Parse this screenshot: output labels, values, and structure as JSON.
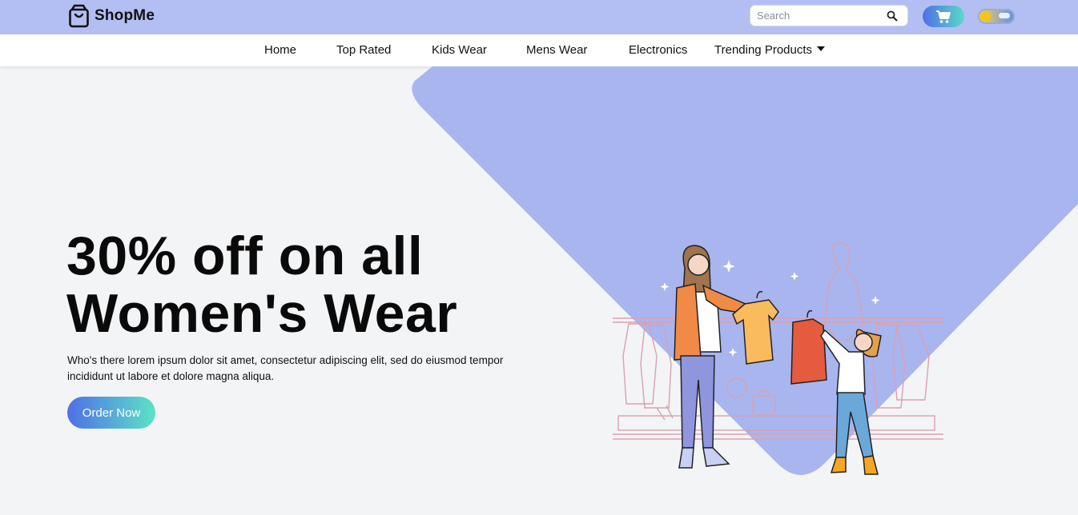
{
  "header": {
    "brand": "ShopMe",
    "search": {
      "placeholder": "Search",
      "value": ""
    }
  },
  "nav": {
    "items": [
      {
        "label": "Home"
      },
      {
        "label": "Top Rated"
      },
      {
        "label": "Kids Wear"
      },
      {
        "label": "Mens Wear"
      },
      {
        "label": "Electronics"
      },
      {
        "label": "Trending Products"
      }
    ]
  },
  "hero": {
    "title_line1": "30% off on all",
    "title_line2": "Women's Wear",
    "description": "Who's there lorem ipsum dolor sit amet, consectetur adipiscing elit, sed do eiusmod tempor incididunt ut labore et dolore magna aliqua.",
    "cta": "Order Now"
  },
  "colors": {
    "topbar": "#b3bef3",
    "shape": "#a9b5ef",
    "gradient_start": "#4f6fe8",
    "gradient_end": "#5ce3c6"
  },
  "icons": {
    "brand": "shopping-bag-icon",
    "search": "search-icon",
    "cart": "cart-icon",
    "theme": "theme-toggle-icon",
    "caret": "caret-down-icon"
  }
}
